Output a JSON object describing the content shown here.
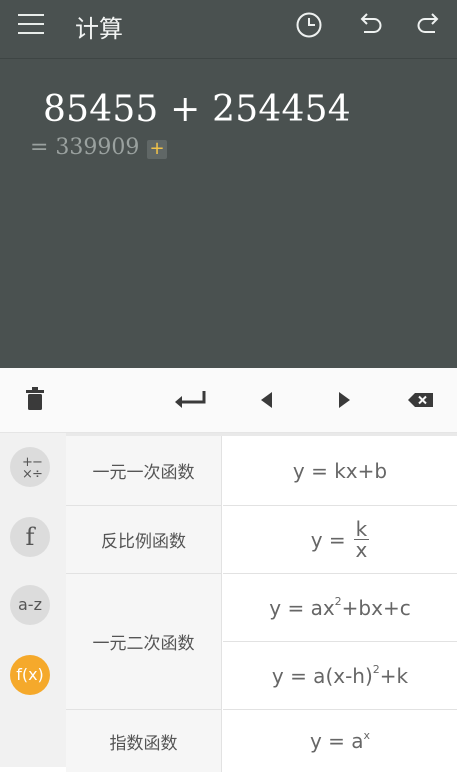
{
  "header": {
    "title": "计算",
    "icons": [
      "menu-icon",
      "history-icon",
      "undo-icon",
      "redo-icon"
    ]
  },
  "display": {
    "expression": "85455 + 254454",
    "result": "= 339909",
    "add_label": "+"
  },
  "toolbar": {
    "icons": [
      "trash-icon",
      "enter-icon",
      "cursor-left-icon",
      "cursor-right-icon",
      "backspace-icon"
    ]
  },
  "categories": [
    {
      "label": "+−\n×÷",
      "icon": "arithmetic-icon",
      "active": false
    },
    {
      "label": "f",
      "icon": "function-icon",
      "active": false
    },
    {
      "label": "a-z",
      "icon": "variable-icon",
      "active": false
    },
    {
      "label": "f(x)",
      "icon": "fx-icon",
      "active": true
    }
  ],
  "formulas": {
    "linear": {
      "name": "一元一次函数",
      "formula": "y = kx+b"
    },
    "inverse": {
      "name": "反比例函数",
      "formula_left": "y =",
      "num": "k",
      "den": "x"
    },
    "quadratic": {
      "name": "一元二次函数",
      "f1_a": "y = ax",
      "f1_sup": "2",
      "f1_b": "+bx+c",
      "f2_a": "y = a(x-h)",
      "f2_sup": "2",
      "f2_b": "+k"
    },
    "exponential": {
      "name": "指数函数",
      "f_a": "y = a",
      "f_sup": "x"
    }
  },
  "colors": {
    "display_bg": "#4a5150",
    "accent": "#f5a92b",
    "add_plus": "#f0c24a"
  }
}
